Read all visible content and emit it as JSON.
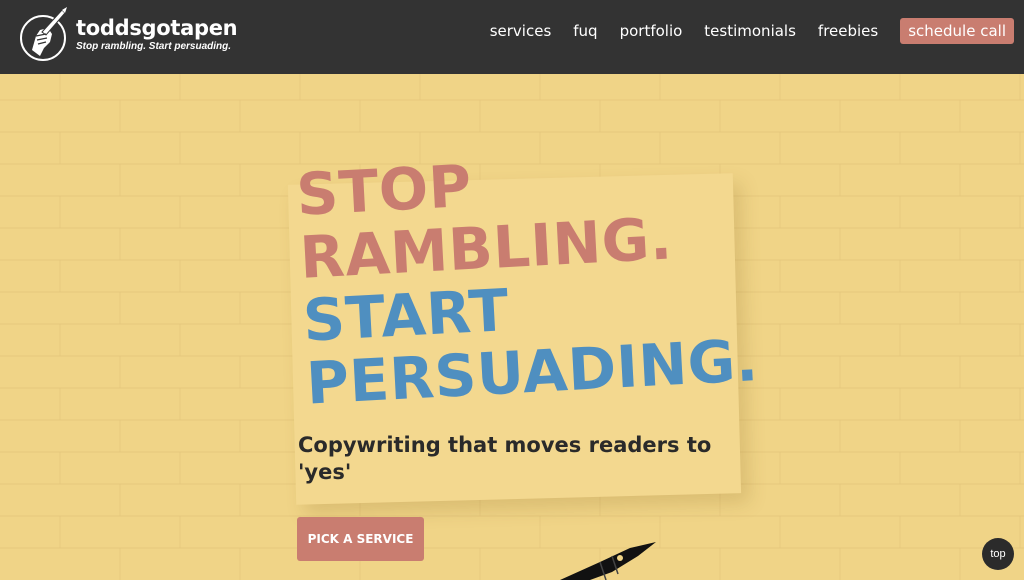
{
  "brand": {
    "name": "toddsgotapen",
    "tagline": "Stop rambling. Start persuading."
  },
  "nav": {
    "items": [
      {
        "label": "services"
      },
      {
        "label": "fuq"
      },
      {
        "label": "portfolio"
      },
      {
        "label": "testimonials"
      },
      {
        "label": "freebies"
      }
    ],
    "cta_label": "schedule call"
  },
  "hero": {
    "headline_line1": "STOP",
    "headline_line2": "RAMBLING.",
    "headline_line3": "START",
    "headline_line4": "PERSUADING.",
    "subhead": "Copywriting that moves readers to 'yes'",
    "cta_label": "PICK A SERVICE"
  },
  "scroll_top_label": "top",
  "colors": {
    "header_bg": "#333333",
    "page_bg": "#f0d487",
    "accent_pink": "#c97d70",
    "accent_blue": "#4f8fc0",
    "text_dark": "#2a2a2a"
  },
  "icons": {
    "logo": "fist-holding-pen-icon",
    "decor": "fountain-pen-nib-icon"
  }
}
